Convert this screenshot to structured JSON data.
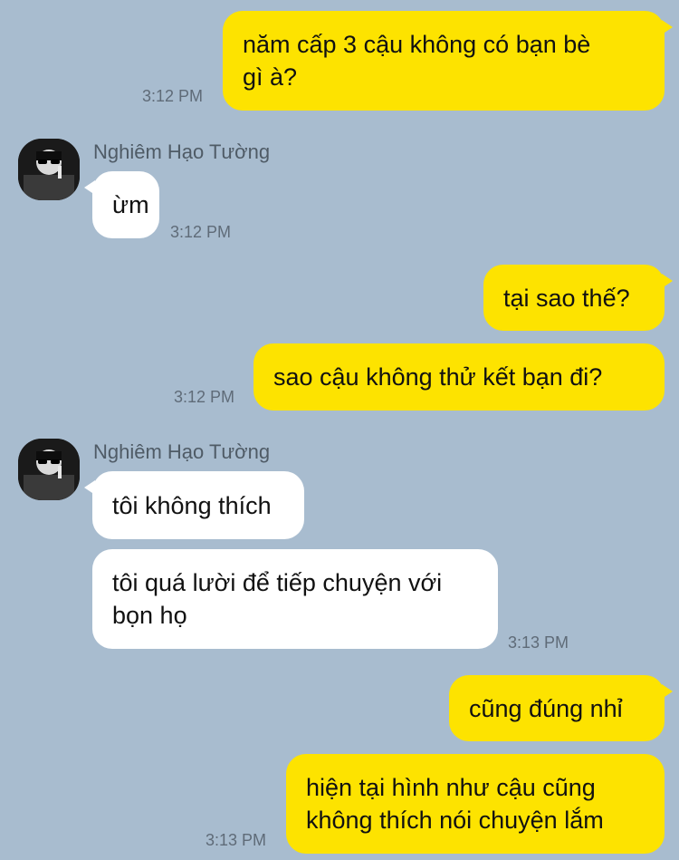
{
  "theme": {
    "background": "#a8bccf",
    "outgoing_bubble": "#fde300",
    "incoming_bubble": "#ffffff"
  },
  "messages": [
    {
      "direction": "out",
      "lines": [
        "năm cấp 3 cậu không có bạn bè",
        "gì à?"
      ],
      "time": "3:12 PM"
    },
    {
      "direction": "in",
      "sender": "Nghiêm Hạo Tường",
      "avatar": "profile-photo",
      "lines": [
        "ừm"
      ],
      "time": "3:12 PM"
    },
    {
      "direction": "out",
      "lines": [
        "tại sao thế?"
      ]
    },
    {
      "direction": "out",
      "lines": [
        "sao cậu không thử kết bạn đi?"
      ],
      "time": "3:12 PM"
    },
    {
      "direction": "in",
      "sender": "Nghiêm Hạo Tường",
      "avatar": "profile-photo",
      "lines": [
        "tôi không thích"
      ]
    },
    {
      "direction": "in",
      "lines": [
        "tôi quá lười để tiếp chuyện với",
        "bọn họ"
      ],
      "time": "3:13 PM"
    },
    {
      "direction": "out",
      "lines": [
        "cũng đúng nhỉ"
      ]
    },
    {
      "direction": "out",
      "lines": [
        "hiện tại hình như cậu cũng",
        "không thích nói chuyện lắm"
      ],
      "time": "3:13 PM"
    }
  ]
}
